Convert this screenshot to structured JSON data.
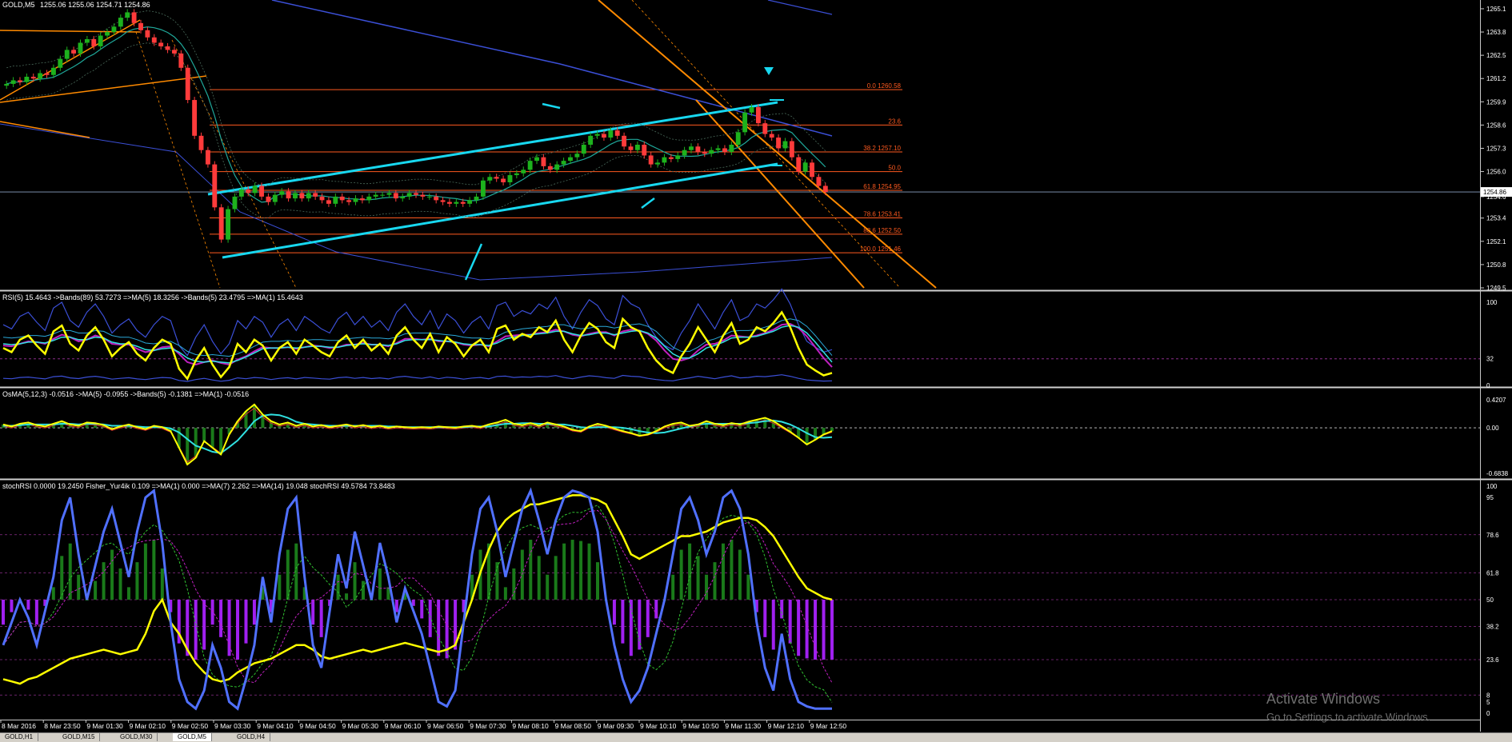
{
  "window": {
    "symbol_label": "GOLD,M5",
    "ohlc": "1255.06 1255.06 1254.71 1254.86",
    "tabs": [
      "GOLD,H1",
      "GOLD,M15",
      "GOLD,M30",
      "GOLD,M5",
      "GOLD,H4"
    ],
    "active_tab": 3
  },
  "watermark": {
    "line1": "Activate Windows",
    "line2": "Go to Settings to activate Windows."
  },
  "colors": {
    "background": "#000000",
    "up_candle": "#1db21d",
    "down_candle": "#ff3b3b",
    "fib": "#ff5a1f",
    "channel": "#18d8f0",
    "blue_ma": "#3b4fd6",
    "orange_channel": "#ff8a00",
    "yellow": "#ffff00",
    "magenta": "#c020c0",
    "cyan_line": "#30e0e0",
    "hist_green": "#1a7a1a",
    "hist_purple": "#a020f0",
    "stoch_blue": "#5070ff"
  },
  "chart_data": [
    {
      "type": "candlestick",
      "title": "GOLD,M5 1255.06 1255.06 1254.71 1254.86",
      "ylim": [
        1249.5,
        1265.5
      ],
      "y_ticks": [
        "1265.1",
        "1263.8",
        "1262.5",
        "1261.2",
        "1259.9",
        "1258.6",
        "1257.3",
        "1256.0",
        "1254.6",
        "1253.4",
        "1252.1",
        "1250.8",
        "1249.5"
      ],
      "current_price_label": "1254.86",
      "x_ticks": [
        "8 Mar 2016",
        "8 Mar 23:50",
        "9 Mar 01:30",
        "9 Mar 02:10",
        "9 Mar 02:50",
        "9 Mar 03:30",
        "9 Mar 04:10",
        "9 Mar 04:50",
        "9 Mar 05:30",
        "9 Mar 06:10",
        "9 Mar 06:50",
        "9 Mar 07:30",
        "9 Mar 08:10",
        "9 Mar 08:50",
        "9 Mar 09:30",
        "9 Mar 10:10",
        "9 Mar 10:50",
        "9 Mar 11:30",
        "9 Mar 12:10",
        "9 Mar 12:50"
      ],
      "close": [
        1260.9,
        1261.1,
        1261.0,
        1261.3,
        1261.2,
        1261.5,
        1261.4,
        1261.8,
        1262.3,
        1262.8,
        1262.6,
        1263.2,
        1263.4,
        1263.0,
        1263.6,
        1263.8,
        1264.1,
        1264.6,
        1264.9,
        1264.3,
        1263.9,
        1263.5,
        1263.2,
        1263.0,
        1262.8,
        1262.6,
        1261.8,
        1260.0,
        1258.0,
        1257.2,
        1256.4,
        1254.0,
        1252.2,
        1253.9,
        1254.6,
        1255.0,
        1254.8,
        1255.2,
        1254.6,
        1254.3,
        1254.7,
        1254.9,
        1254.5,
        1254.8,
        1254.5,
        1254.8,
        1254.6,
        1254.4,
        1254.2,
        1254.6,
        1254.4,
        1254.3,
        1254.5,
        1254.4,
        1254.6,
        1254.7,
        1254.7,
        1254.8,
        1254.5,
        1254.6,
        1254.8,
        1254.7,
        1254.6,
        1254.6,
        1254.4,
        1254.3,
        1254.2,
        1254.3,
        1254.2,
        1254.4,
        1254.6,
        1255.5,
        1255.7,
        1255.6,
        1255.4,
        1255.8,
        1255.9,
        1256.1,
        1256.6,
        1256.8,
        1256.3,
        1256.1,
        1256.4,
        1256.6,
        1256.8,
        1257.0,
        1257.5,
        1258.0,
        1258.1,
        1257.9,
        1258.3,
        1258.0,
        1257.4,
        1257.2,
        1257.5,
        1256.9,
        1256.4,
        1256.5,
        1256.8,
        1256.7,
        1256.9,
        1257.2,
        1257.4,
        1257.1,
        1257.0,
        1257.2,
        1257.3,
        1257.1,
        1257.5,
        1258.2,
        1259.3,
        1259.6,
        1258.7,
        1258.1,
        1257.9,
        1257.3,
        1257.7,
        1256.8,
        1256.0,
        1256.5,
        1255.7,
        1255.2,
        1254.86
      ],
      "fibonacci": [
        {
          "level": "0.0",
          "price": 1260.58,
          "label": "0.0 1260.58"
        },
        {
          "level": "23.6",
          "price": 1258.6,
          "label": "23.6"
        },
        {
          "level": "38.2",
          "price": 1257.1,
          "label": "38.2 1257.10"
        },
        {
          "level": "50.0",
          "price": 1256.0,
          "label": "50.0"
        },
        {
          "level": "61.8",
          "price": 1254.95,
          "label": "61.8 1254.95"
        },
        {
          "level": "78.6",
          "price": 1253.41,
          "label": "78.6 1253.41"
        },
        {
          "level": "88.6",
          "price": 1252.5,
          "label": "88.6 1252.50"
        },
        {
          "level": "100.0",
          "price": 1251.46,
          "label": "100.0 1251.46"
        }
      ]
    },
    {
      "type": "line",
      "title": "RSI(5) 15.4643 ->Bands(89) 53.7273 =>MA(5) 18.3256 ->Bands(5) 23.4795 =>MA(1) 15.4643",
      "ylim": [
        0,
        100
      ],
      "y_ticks": [
        "100",
        "32",
        "0"
      ],
      "level": 32,
      "series": [
        {
          "name": "RSI(5)",
          "values": [
            45,
            40,
            55,
            60,
            48,
            38,
            65,
            72,
            50,
            42,
            60,
            70,
            55,
            35,
            45,
            52,
            38,
            30,
            45,
            55,
            50,
            20,
            8,
            30,
            45,
            25,
            10,
            22,
            50,
            40,
            55,
            48,
            30,
            45,
            52,
            38,
            55,
            48,
            40,
            35,
            52,
            60,
            45,
            55,
            42,
            50,
            38,
            60,
            70,
            55,
            45,
            62,
            40,
            58,
            50,
            35,
            48,
            55,
            40,
            68,
            72,
            55,
            62,
            58,
            70,
            64,
            78,
            55,
            40,
            60,
            75,
            68,
            52,
            45,
            80,
            70,
            65,
            45,
            30,
            20,
            15,
            35,
            50,
            70,
            55,
            40,
            60,
            75,
            50,
            55,
            70,
            65,
            75,
            88,
            70,
            45,
            25,
            18,
            12,
            15
          ]
        },
        {
          "name": "MA(5)",
          "values": [
            48,
            47,
            50,
            53,
            52,
            50,
            56,
            61,
            58,
            53,
            55,
            60,
            57,
            50,
            49,
            49,
            44,
            40,
            42,
            46,
            47,
            38,
            28,
            25,
            28,
            30,
            27,
            25,
            31,
            35,
            41,
            46,
            45,
            45,
            46,
            44,
            46,
            48,
            47,
            45,
            46,
            49,
            49,
            51,
            49,
            49,
            47,
            51,
            56,
            56,
            55,
            56,
            53,
            53,
            52,
            49,
            48,
            49,
            47,
            53,
            59,
            60,
            61,
            61,
            63,
            64,
            67,
            65,
            61,
            59,
            62,
            64,
            64,
            60,
            65,
            67,
            66,
            62,
            54,
            42,
            32,
            30,
            33,
            42,
            49,
            50,
            54,
            60,
            59,
            58,
            60,
            63,
            67,
            73,
            74,
            69,
            59,
            46,
            33,
            22
          ]
        },
        {
          "name": "Bands(5)",
          "values": [
            50,
            49,
            50,
            52,
            52,
            51,
            54,
            58,
            58,
            55,
            55,
            58,
            57,
            52,
            50,
            50,
            47,
            43,
            42,
            44,
            45,
            40,
            33,
            29,
            28,
            29,
            28,
            27,
            30,
            34,
            39,
            44,
            45,
            45,
            46,
            45,
            46,
            47,
            47,
            46,
            46,
            48,
            49,
            50,
            49,
            49,
            48,
            50,
            54,
            55,
            55,
            55,
            54,
            53,
            52,
            50,
            49,
            49,
            48,
            51,
            56,
            58,
            60,
            61,
            62,
            63,
            65,
            65,
            62,
            60,
            61,
            63,
            63,
            61,
            63,
            65,
            66,
            63,
            57,
            47,
            38,
            33,
            33,
            38,
            45,
            48,
            52,
            57,
            58,
            58,
            59,
            62,
            65,
            70,
            72,
            70,
            63,
            52,
            40,
            28
          ]
        }
      ]
    },
    {
      "type": "line",
      "title": "OsMA(5,12,3) -0.0516 ->MA(5) -0.0955 ->Bands(5) -0.1381 =>MA(1) -0.0516",
      "ylim": [
        -0.6838,
        0.4207
      ],
      "y_ticks": [
        "0.4207",
        "0.00",
        "-0.6838"
      ],
      "series": [
        {
          "name": "OsMA(5,12,3)",
          "values": [
            0.05,
            0.02,
            0.06,
            0.08,
            0.04,
            0.02,
            0.06,
            0.1,
            0.05,
            0.03,
            0.08,
            0.07,
            0.04,
            -0.02,
            0.02,
            0.05,
            0.01,
            -0.02,
            0.03,
            0.01,
            -0.05,
            -0.3,
            -0.55,
            -0.45,
            -0.2,
            -0.3,
            -0.4,
            -0.1,
            0.1,
            0.25,
            0.35,
            0.2,
            0.1,
            0.05,
            0.08,
            0.03,
            0.06,
            0.02,
            0.04,
            0.01,
            0.03,
            0.05,
            0.02,
            0.04,
            0.01,
            0.03,
            0.0,
            0.02,
            0.01,
            0.0,
            0.01,
            0.0,
            0.02,
            0.01,
            0.0,
            0.02,
            0.03,
            0.01,
            0.05,
            0.08,
            0.12,
            0.06,
            0.04,
            0.07,
            0.03,
            0.08,
            0.05,
            0.02,
            -0.03,
            -0.05,
            0.02,
            0.06,
            0.03,
            -0.01,
            -0.05,
            -0.08,
            -0.12,
            -0.1,
            -0.05,
            0.02,
            0.06,
            0.08,
            0.03,
            0.05,
            0.1,
            0.06,
            0.04,
            0.07,
            0.05,
            0.09,
            0.12,
            0.15,
            0.1,
            0.02,
            -0.06,
            -0.15,
            -0.25,
            -0.18,
            -0.1,
            -0.05
          ]
        },
        {
          "name": "MA(5)",
          "values": [
            0.03,
            0.03,
            0.04,
            0.05,
            0.05,
            0.05,
            0.05,
            0.06,
            0.06,
            0.05,
            0.06,
            0.06,
            0.05,
            0.03,
            0.03,
            0.03,
            0.02,
            0.01,
            0.01,
            0.01,
            -0.01,
            -0.07,
            -0.17,
            -0.27,
            -0.31,
            -0.36,
            -0.38,
            -0.29,
            -0.19,
            -0.05,
            0.1,
            0.18,
            0.2,
            0.19,
            0.15,
            0.09,
            0.06,
            0.05,
            0.04,
            0.03,
            0.03,
            0.03,
            0.03,
            0.03,
            0.03,
            0.03,
            0.02,
            0.02,
            0.01,
            0.01,
            0.01,
            0.01,
            0.01,
            0.01,
            0.01,
            0.01,
            0.02,
            0.02,
            0.02,
            0.04,
            0.06,
            0.06,
            0.07,
            0.07,
            0.06,
            0.06,
            0.05,
            0.05,
            0.03,
            0.01,
            0.0,
            0.01,
            0.01,
            0.01,
            0.0,
            -0.02,
            -0.05,
            -0.07,
            -0.08,
            -0.07,
            -0.04,
            -0.01,
            0.02,
            0.05,
            0.06,
            0.06,
            0.06,
            0.06,
            0.06,
            0.07,
            0.08,
            0.1,
            0.11,
            0.09,
            0.05,
            -0.01,
            -0.08,
            -0.14,
            -0.15,
            -0.14
          ]
        }
      ]
    },
    {
      "type": "line",
      "title": "stochRSI 0.0000 19.2450 Fisher_Yur4ik 0.109 =>MA(1) 0.000 =>MA(7) 2.262 =>MA(14) 19.048 stochRSI 49.5784 73.8483",
      "ylim": [
        0,
        100
      ],
      "y_ticks": [
        "100",
        "95",
        "78.6",
        "61.8",
        "50",
        "38.2",
        "23.6",
        "8",
        "5",
        "0"
      ],
      "series": [
        {
          "name": "stochRSI",
          "values": [
            30,
            40,
            50,
            42,
            30,
            45,
            60,
            85,
            95,
            70,
            50,
            65,
            80,
            90,
            75,
            60,
            80,
            95,
            98,
            75,
            40,
            15,
            5,
            2,
            10,
            30,
            20,
            5,
            2,
            15,
            30,
            60,
            40,
            70,
            90,
            95,
            60,
            30,
            20,
            45,
            70,
            55,
            80,
            65,
            50,
            75,
            60,
            40,
            55,
            45,
            35,
            20,
            5,
            3,
            10,
            40,
            70,
            90,
            95,
            80,
            60,
            75,
            90,
            98,
            85,
            70,
            85,
            95,
            98,
            97,
            95,
            80,
            50,
            30,
            15,
            5,
            10,
            20,
            35,
            50,
            70,
            90,
            95,
            85,
            70,
            80,
            95,
            98,
            90,
            70,
            40,
            20,
            10,
            35,
            15,
            5,
            3,
            2,
            2,
            2
          ]
        },
        {
          "name": "stochRSI slow",
          "values": [
            15,
            14,
            13,
            15,
            16,
            18,
            20,
            22,
            24,
            25,
            26,
            27,
            28,
            27,
            26,
            27,
            28,
            35,
            45,
            50,
            40,
            35,
            28,
            22,
            18,
            15,
            14,
            15,
            18,
            20,
            22,
            23,
            24,
            26,
            28,
            30,
            30,
            28,
            25,
            24,
            25,
            26,
            27,
            28,
            27,
            28,
            29,
            30,
            31,
            30,
            29,
            28,
            27,
            28,
            30,
            40,
            50,
            62,
            72,
            80,
            85,
            88,
            90,
            92,
            92,
            93,
            94,
            95,
            96,
            96,
            95,
            94,
            92,
            85,
            78,
            70,
            68,
            70,
            72,
            74,
            76,
            78,
            78,
            79,
            80,
            82,
            84,
            85,
            86,
            86,
            85,
            82,
            78,
            72,
            66,
            60,
            55,
            53,
            51,
            50
          ]
        }
      ]
    }
  ]
}
